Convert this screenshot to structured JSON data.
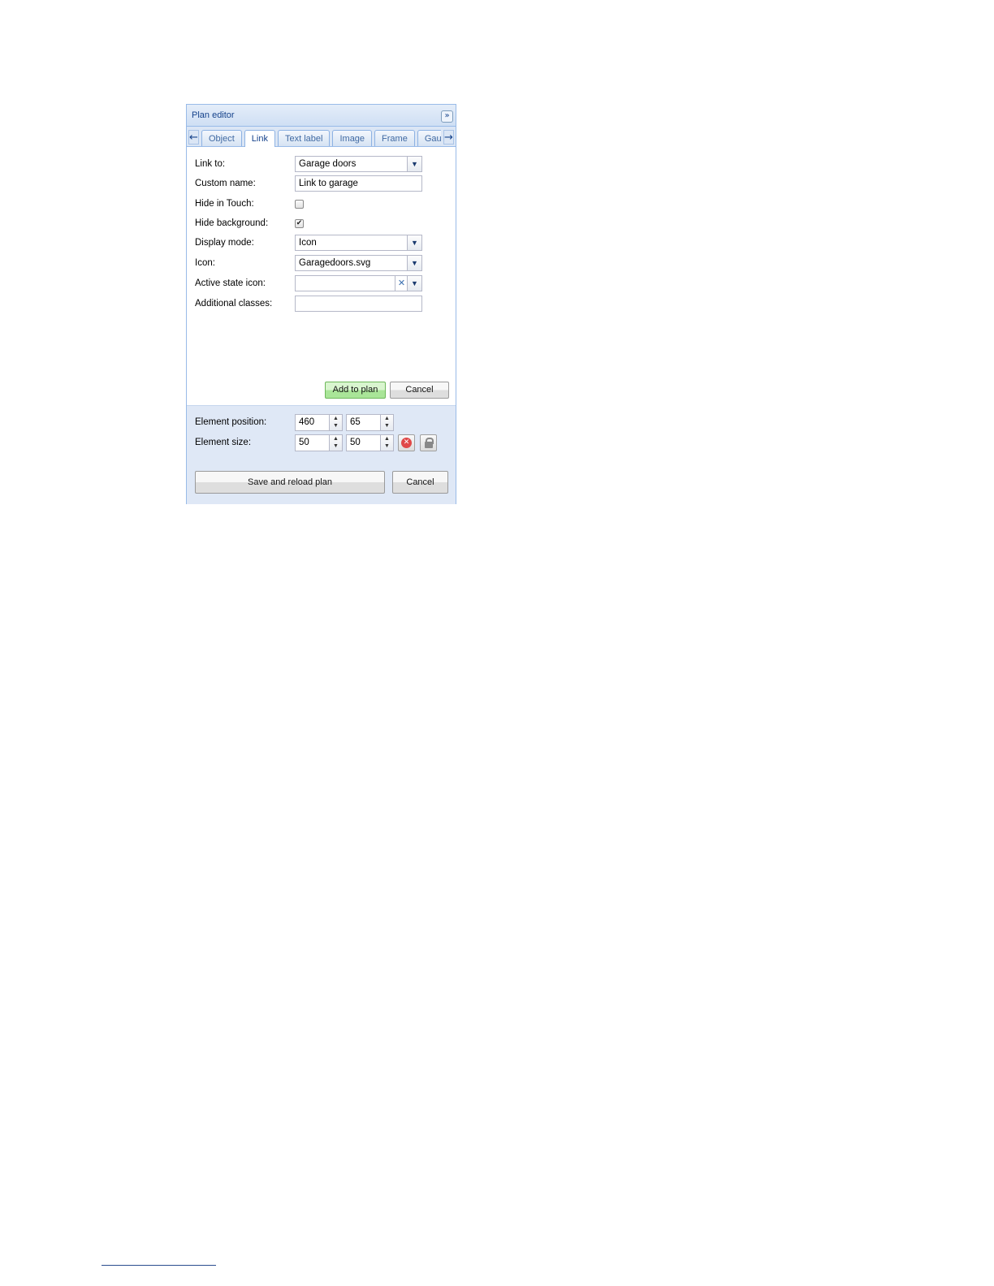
{
  "panel": {
    "title": "Plan editor",
    "collapse_glyph": "»"
  },
  "tabs": {
    "scroll_left_icon": "arrow-left-icon",
    "scroll_right_icon": "arrow-right-icon",
    "items": [
      {
        "label": "Object",
        "active": false
      },
      {
        "label": "Link",
        "active": true
      },
      {
        "label": "Text label",
        "active": false
      },
      {
        "label": "Image",
        "active": false
      },
      {
        "label": "Frame",
        "active": false
      },
      {
        "label": "Gau",
        "active": false
      }
    ]
  },
  "form": {
    "link_to": {
      "label": "Link to:",
      "value": "Garage doors"
    },
    "custom_name": {
      "label": "Custom name:",
      "value": "Link to garage"
    },
    "hide_in_touch": {
      "label": "Hide in Touch:",
      "checked": false
    },
    "hide_background": {
      "label": "Hide background:",
      "checked": true
    },
    "display_mode": {
      "label": "Display mode:",
      "value": "Icon"
    },
    "icon": {
      "label": "Icon:",
      "value": "Garagedoors.svg"
    },
    "active_state_icon": {
      "label": "Active state icon:",
      "value": ""
    },
    "additional_classes": {
      "label": "Additional classes:",
      "value": ""
    },
    "add_button": "Add to plan",
    "cancel_button": "Cancel"
  },
  "element": {
    "position_label": "Element position:",
    "position_x": "460",
    "position_y": "65",
    "size_label": "Element size:",
    "size_w": "50",
    "size_h": "50"
  },
  "footer": {
    "save_button": "Save and reload plan",
    "cancel_button": "Cancel"
  },
  "colors": {
    "accent": "#15428b",
    "panel_border": "#99bbe8",
    "bottom_bg": "#dfe8f6",
    "green_button": "#a9e598"
  }
}
